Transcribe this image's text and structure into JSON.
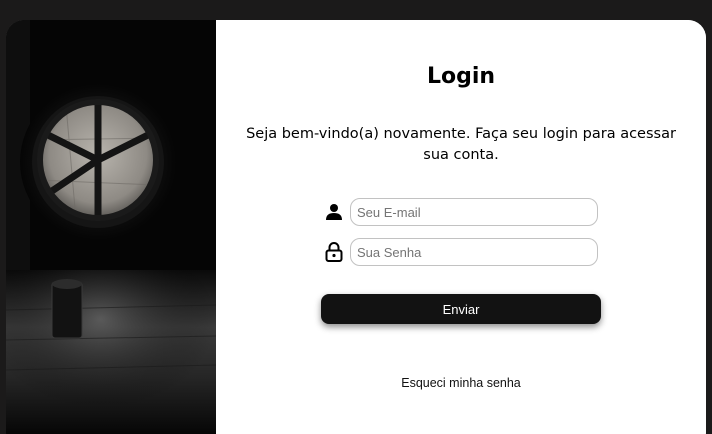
{
  "login": {
    "title": "Login",
    "subtitle": "Seja bem-vindo(a) novamente. Faça seu login para acessar sua conta.",
    "email": {
      "icon": "user-icon",
      "placeholder": "Seu E-mail",
      "value": ""
    },
    "password": {
      "icon": "lock-icon",
      "placeholder": "Sua Senha",
      "value": ""
    },
    "submit_label": "Enviar",
    "forgot_label": "Esqueci minha senha"
  },
  "image": {
    "description_icon": "round-window-photo"
  },
  "colors": {
    "background": "#1b1a1a",
    "card": "#ffffff",
    "button": "#121212",
    "button_text": "#ffffff",
    "input_border": "#c2c2c2"
  }
}
